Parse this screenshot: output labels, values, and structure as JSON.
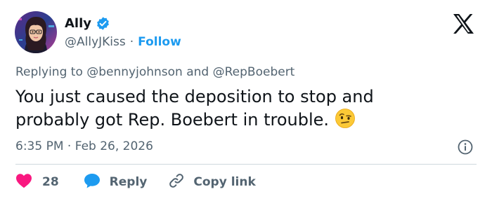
{
  "user": {
    "display_name": "Ally",
    "handle": "@AllyJKiss",
    "separator": "·",
    "follow_label": "Follow"
  },
  "reply_context": {
    "prefix": "Replying to",
    "mention1": "@bennyjohnson",
    "conjunction": "and",
    "mention2": "@RepBoebert"
  },
  "tweet": {
    "text": "You just caused the deposition to stop and probably got Rep. Boebert in trouble.",
    "emoji": "face-with-raised-eyebrow"
  },
  "meta": {
    "time": "6:35 PM",
    "separator": "·",
    "date": "Feb 26, 2026"
  },
  "actions": {
    "like_count": "28",
    "reply_label": "Reply",
    "copy_label": "Copy link"
  },
  "colors": {
    "accent": "#1d9bf0",
    "like": "#f91880",
    "text": "#0f1419",
    "muted": "#536471",
    "divider": "#cfd9de"
  },
  "icons": [
    "verified-badge-icon",
    "x-logo-icon",
    "info-icon",
    "heart-icon",
    "reply-bubble-icon",
    "link-icon"
  ]
}
